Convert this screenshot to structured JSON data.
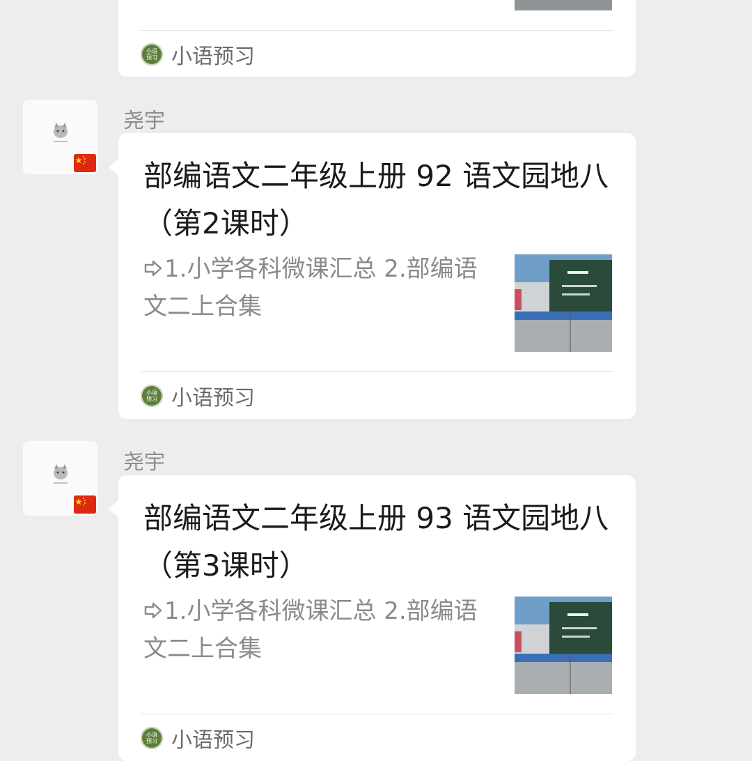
{
  "messages": [
    {
      "sender": "",
      "title": "",
      "desc": "",
      "source": "小语预习"
    },
    {
      "sender": "尧宇",
      "title": "部编语文二年级上册 92 语文园地八（第2课时）",
      "desc": "1.小学各科微课汇总   2.部编语文二上合集",
      "source": "小语预习"
    },
    {
      "sender": "尧宇",
      "title": "部编语文二年级上册 93 语文园地八（第3课时）",
      "desc": "1.小学各科微课汇总   2.部编语文二上合集",
      "source": "小语预习"
    }
  ],
  "source_logo_text": "小语预习",
  "colors": {
    "background": "#ededed",
    "card": "#ffffff",
    "title": "#1a1a1a",
    "desc": "#8a8a8a",
    "logo": "#5b7f3a",
    "flag": "#de2910"
  },
  "icons": {
    "arrow": "arrow-right-icon",
    "flag": "china-flag-icon",
    "avatar": "cat-avatar-icon"
  }
}
